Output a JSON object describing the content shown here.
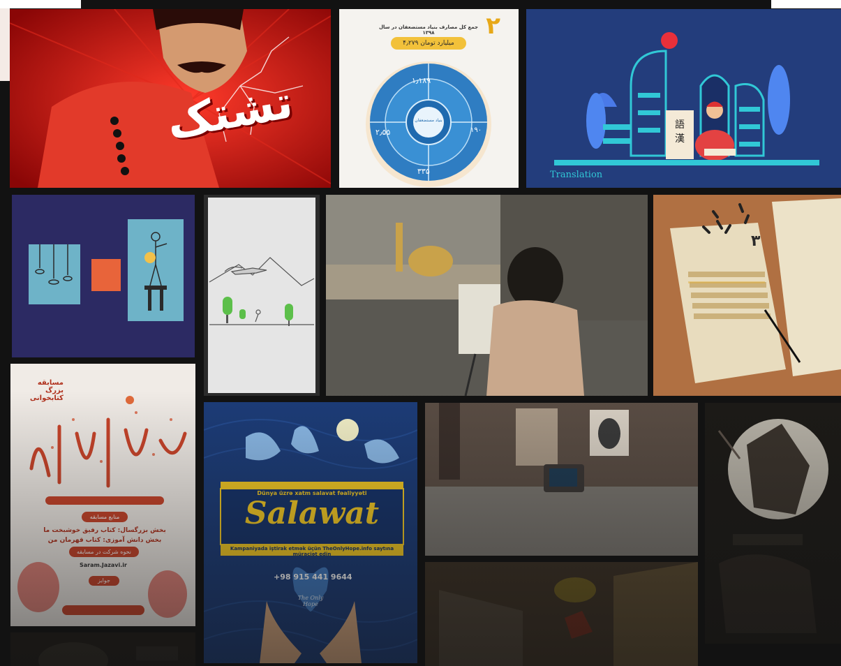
{
  "gallery": {
    "tiles": [
      {
        "id": "tashak",
        "text": "تشتک"
      },
      {
        "id": "infographic",
        "title": "جمع کل مصارف بنیاد مستضعفان در سال ۱۳۹۸",
        "number": "۲",
        "total": "۴٫۲۷۹ میلیارد تومان",
        "center": "بنیاد مستضعفان",
        "seg_top": "۱٫۱۸۹",
        "seg_left": "۲٫۵۵",
        "seg_right": "۱۹۰",
        "seg_bottom": "۳۳۵"
      },
      {
        "id": "translation",
        "caption": "Translation",
        "glyph1": "語",
        "glyph2": "漢"
      },
      {
        "id": "illustration-blue"
      },
      {
        "id": "sketch"
      },
      {
        "id": "shrine-painter"
      },
      {
        "id": "documents",
        "number": "۳"
      },
      {
        "id": "poster-competition",
        "corner": "مسابقه بزرگ کتابخوانی",
        "button1": "منابع مسابقه",
        "line1": "بخش بزرگسال: کتاب رفیق خوشبخت ما",
        "line2": "بخش دانش آموزی: کتاب قهرمان من",
        "button2": "نحوه شرکت در مسابقه",
        "url": "Saram.Jazavi.ir",
        "button3": "جوایز"
      },
      {
        "id": "salawat",
        "banner": "Dünya üzrə xatm salavat fəaliyyəti",
        "title": "Salawat",
        "subline": "Kampaniyada iştirak etmək üçün TheOnlyHope.info saytına müraciət edin",
        "phone": "+98 915 441 9644",
        "heart": "The Only Hope"
      },
      {
        "id": "tv-room"
      },
      {
        "id": "warrior"
      },
      {
        "id": "courtyard"
      },
      {
        "id": "dark-bottom"
      }
    ]
  }
}
